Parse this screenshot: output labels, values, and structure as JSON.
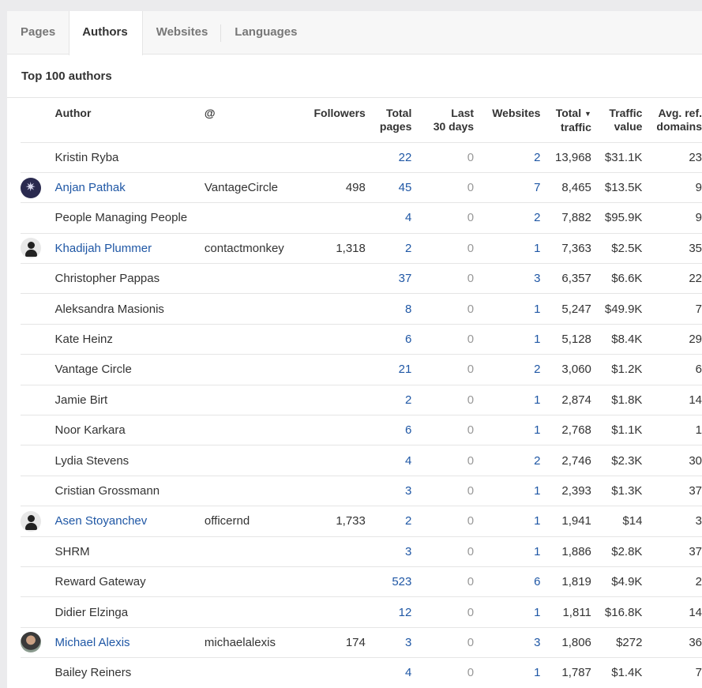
{
  "tabs": [
    {
      "label": "Pages",
      "active": false
    },
    {
      "label": "Authors",
      "active": true
    },
    {
      "label": "Websites",
      "active": false
    },
    {
      "label": "Languages",
      "active": false
    }
  ],
  "section_title": "Top 100 authors",
  "columns": {
    "author": "Author",
    "at": "@",
    "followers": "Followers",
    "total_pages_1": "Total",
    "total_pages_2": "pages",
    "last30_1": "Last",
    "last30_2": "30 days",
    "websites": "Websites",
    "total_traffic_1": "Total",
    "total_traffic_2": "traffic",
    "sort_icon": "▼",
    "traffic_value_1": "Traffic",
    "traffic_value_2": "value",
    "avg_ref_1": "Avg. ref.",
    "avg_ref_2": "domains"
  },
  "colors": {
    "link": "#1f57a5",
    "muted": "#999999",
    "background": "#ebebed"
  },
  "rows": [
    {
      "avatar": "none",
      "name": "Kristin Ryba",
      "linked": false,
      "handle": "",
      "followers": "",
      "total_pages": "22",
      "last30": "0",
      "websites": "2",
      "total_traffic": "13,968",
      "traffic_value": "$31.1K",
      "avg_ref": "23"
    },
    {
      "avatar": "vantage-logo",
      "name": "Anjan Pathak",
      "linked": true,
      "handle": "VantageCircle",
      "followers": "498",
      "total_pages": "45",
      "last30": "0",
      "websites": "7",
      "total_traffic": "8,465",
      "traffic_value": "$13.5K",
      "avg_ref": "9"
    },
    {
      "avatar": "none",
      "name": "People Managing People",
      "linked": false,
      "handle": "",
      "followers": "",
      "total_pages": "4",
      "last30": "0",
      "websites": "2",
      "total_traffic": "7,882",
      "traffic_value": "$95.9K",
      "avg_ref": "9"
    },
    {
      "avatar": "default-person",
      "name": "Khadijah Plummer",
      "linked": true,
      "handle": "contactmonkey",
      "followers": "1,318",
      "total_pages": "2",
      "last30": "0",
      "websites": "1",
      "total_traffic": "7,363",
      "traffic_value": "$2.5K",
      "avg_ref": "35"
    },
    {
      "avatar": "none",
      "name": "Christopher Pappas",
      "linked": false,
      "handle": "",
      "followers": "",
      "total_pages": "37",
      "last30": "0",
      "websites": "3",
      "total_traffic": "6,357",
      "traffic_value": "$6.6K",
      "avg_ref": "22"
    },
    {
      "avatar": "none",
      "name": "Aleksandra Masionis",
      "linked": false,
      "handle": "",
      "followers": "",
      "total_pages": "8",
      "last30": "0",
      "websites": "1",
      "total_traffic": "5,247",
      "traffic_value": "$49.9K",
      "avg_ref": "7"
    },
    {
      "avatar": "none",
      "name": "Kate Heinz",
      "linked": false,
      "handle": "",
      "followers": "",
      "total_pages": "6",
      "last30": "0",
      "websites": "1",
      "total_traffic": "5,128",
      "traffic_value": "$8.4K",
      "avg_ref": "29"
    },
    {
      "avatar": "none",
      "name": "Vantage Circle",
      "linked": false,
      "handle": "",
      "followers": "",
      "total_pages": "21",
      "last30": "0",
      "websites": "2",
      "total_traffic": "3,060",
      "traffic_value": "$1.2K",
      "avg_ref": "6"
    },
    {
      "avatar": "none",
      "name": "Jamie Birt",
      "linked": false,
      "handle": "",
      "followers": "",
      "total_pages": "2",
      "last30": "0",
      "websites": "1",
      "total_traffic": "2,874",
      "traffic_value": "$1.8K",
      "avg_ref": "14"
    },
    {
      "avatar": "none",
      "name": "Noor Karkara",
      "linked": false,
      "handle": "",
      "followers": "",
      "total_pages": "6",
      "last30": "0",
      "websites": "1",
      "total_traffic": "2,768",
      "traffic_value": "$1.1K",
      "avg_ref": "1"
    },
    {
      "avatar": "none",
      "name": "Lydia Stevens",
      "linked": false,
      "handle": "",
      "followers": "",
      "total_pages": "4",
      "last30": "0",
      "websites": "2",
      "total_traffic": "2,746",
      "traffic_value": "$2.3K",
      "avg_ref": "30"
    },
    {
      "avatar": "none",
      "name": "Cristian Grossmann",
      "linked": false,
      "handle": "",
      "followers": "",
      "total_pages": "3",
      "last30": "0",
      "websites": "1",
      "total_traffic": "2,393",
      "traffic_value": "$1.3K",
      "avg_ref": "37"
    },
    {
      "avatar": "default-person",
      "name": "Asen Stoyanchev",
      "linked": true,
      "handle": "officernd",
      "followers": "1,733",
      "total_pages": "2",
      "last30": "0",
      "websites": "1",
      "total_traffic": "1,941",
      "traffic_value": "$14",
      "avg_ref": "3"
    },
    {
      "avatar": "none",
      "name": "SHRM",
      "linked": false,
      "handle": "",
      "followers": "",
      "total_pages": "3",
      "last30": "0",
      "websites": "1",
      "total_traffic": "1,886",
      "traffic_value": "$2.8K",
      "avg_ref": "37"
    },
    {
      "avatar": "none",
      "name": "Reward Gateway",
      "linked": false,
      "handle": "",
      "followers": "",
      "total_pages": "523",
      "last30": "0",
      "websites": "6",
      "total_traffic": "1,819",
      "traffic_value": "$4.9K",
      "avg_ref": "2"
    },
    {
      "avatar": "none",
      "name": "Didier Elzinga",
      "linked": false,
      "handle": "",
      "followers": "",
      "total_pages": "12",
      "last30": "0",
      "websites": "1",
      "total_traffic": "1,811",
      "traffic_value": "$16.8K",
      "avg_ref": "14"
    },
    {
      "avatar": "photo",
      "name": "Michael Alexis",
      "linked": true,
      "handle": "michaelalexis",
      "followers": "174",
      "total_pages": "3",
      "last30": "0",
      "websites": "3",
      "total_traffic": "1,806",
      "traffic_value": "$272",
      "avg_ref": "36"
    },
    {
      "avatar": "none",
      "name": "Bailey Reiners",
      "linked": false,
      "handle": "",
      "followers": "",
      "total_pages": "4",
      "last30": "0",
      "websites": "1",
      "total_traffic": "1,787",
      "traffic_value": "$1.4K",
      "avg_ref": "7"
    }
  ]
}
